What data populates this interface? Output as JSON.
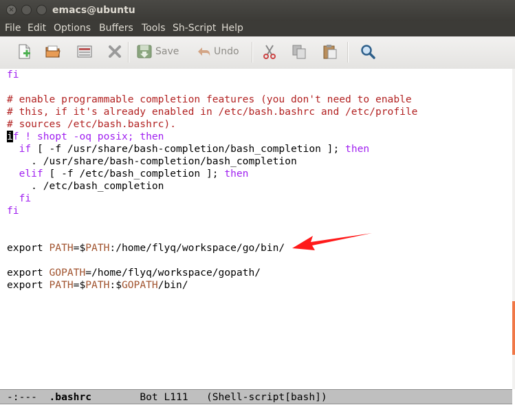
{
  "window": {
    "title": "emacs@ubuntu"
  },
  "menubar": {
    "items": [
      "File",
      "Edit",
      "Options",
      "Buffers",
      "Tools",
      "Sh-Script",
      "Help"
    ]
  },
  "toolbar": {
    "new_icon": "new-file-icon",
    "open_icon": "open-folder-icon",
    "dired_icon": "dired-icon",
    "kill_icon": "close-buffer-icon",
    "save_label": "Save",
    "undo_label": "Undo",
    "cut_icon": "scissors-icon",
    "copy_icon": "copy-icon",
    "paste_icon": "paste-icon",
    "search_icon": "magnifier-icon"
  },
  "editor": {
    "lines": [
      [
        "fi",
        "# enable programmable completion features (you don't need to enable",
        "# this, if it's already enabled in /etc/bash.bashrc and /etc/profile",
        "# sources /etc/bash.bashrc)."
      ],
      {
        "cursor_char": "i",
        "rest": "f ! shopt -oq posix; ",
        "then": "then"
      },
      {
        "indent": "  ",
        "kw_if": "if",
        "body": " [ -f /usr/share/bash-completion/bash_completion ]; ",
        "then": "then"
      },
      "    . /usr/share/bash-completion/bash_completion",
      {
        "indent": "  ",
        "kw_elif": "elif",
        "body": " [ -f /etc/bash_completion ]; ",
        "then": "then"
      },
      "    . /etc/bash_completion",
      "  fi",
      "fi",
      {
        "export": "export ",
        "var": "PATH",
        "eq": "=$",
        "var2": "PATH",
        "rest": ":/home/flyq/workspace/go/bin/"
      },
      {
        "export": "export ",
        "var": "GOPATH",
        "rest": "=/home/flyq/workspace/gopath/"
      },
      {
        "export": "export ",
        "var": "PATH",
        "eq": "=$",
        "var2": "PATH",
        "colon": ":$",
        "var3": "GOPATH",
        "rest": "/bin/"
      }
    ]
  },
  "modeline": {
    "status": "-:---  ",
    "buffer": ".bashrc",
    "position": "        Bot L111   (Shell-script[bash])"
  },
  "colors": {
    "comment": "#b22222",
    "keyword": "#a020f0",
    "variable": "#a0522d",
    "arrow": "#ff0000",
    "accent": "#f07746"
  }
}
